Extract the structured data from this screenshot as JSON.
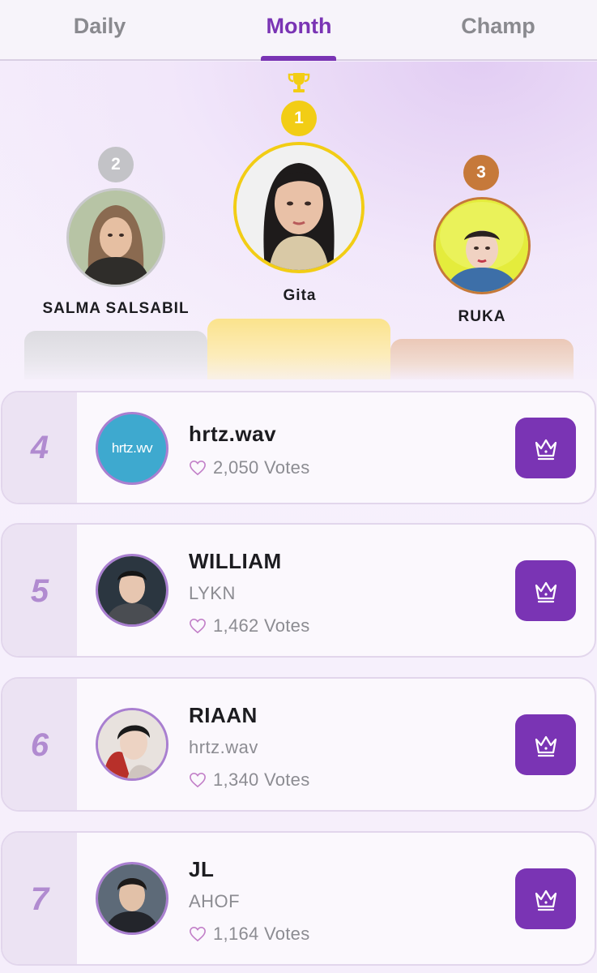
{
  "tabs": [
    {
      "label": "Daily"
    },
    {
      "label": "Month"
    },
    {
      "label": "Champ"
    }
  ],
  "active_tab": "Month",
  "podium": [
    {
      "rank": "1",
      "name": "Gita"
    },
    {
      "rank": "2",
      "name": "SALMA SALSABIL"
    },
    {
      "rank": "3",
      "name": "RUKA"
    }
  ],
  "list": [
    {
      "rank": "4",
      "name": "hrtz.wav",
      "group": "",
      "votes": "2,050 Votes",
      "logo_text": "hrtz.wv"
    },
    {
      "rank": "5",
      "name": "WILLIAM",
      "group": "LYKN",
      "votes": "1,462 Votes"
    },
    {
      "rank": "6",
      "name": "RIAAN",
      "group": "hrtz.wav",
      "votes": "1,340 Votes"
    },
    {
      "rank": "7",
      "name": "JL",
      "group": "AHOF",
      "votes": "1,164 Votes"
    }
  ],
  "colors": {
    "accent": "#7a34b4",
    "gold": "#f2cd15",
    "silver": "#c3c3c7",
    "bronze": "#c6793a",
    "rank_text": "#b18bd0"
  },
  "icons": {
    "trophy": "trophy-icon",
    "vote": "crown-icon",
    "votes": "heart-icon"
  }
}
